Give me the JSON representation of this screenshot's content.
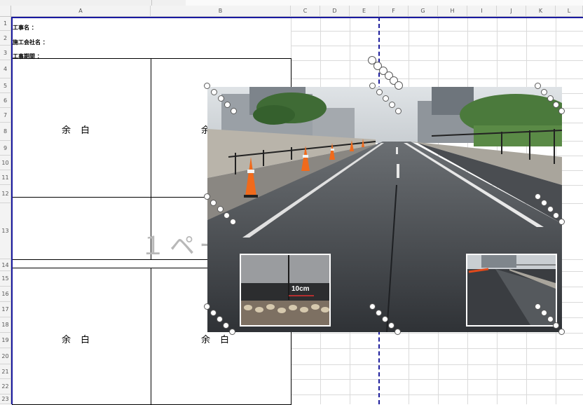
{
  "columns": [
    "A",
    "B",
    "C",
    "D",
    "E",
    "F",
    "G",
    "H",
    "I",
    "J",
    "K",
    "L"
  ],
  "rows": [
    "1",
    "2",
    "3",
    "4",
    "5",
    "6",
    "7",
    "8",
    "9",
    "10",
    "11",
    "12",
    "13",
    "14",
    "15",
    "16",
    "17",
    "18",
    "19",
    "20",
    "21",
    "22",
    "23"
  ],
  "header_fields": {
    "project_name": "工事名 ：",
    "contractor": "施工会社名 ：",
    "period": "工事期間 ："
  },
  "blank_label": "余白",
  "page_watermark": "１ページ",
  "photo": {
    "inset_cut_label": "10cm"
  },
  "colors": {
    "page_border": "#1a1aa0",
    "header_bg": "#f3f3f3",
    "gridline": "#dadada",
    "handle": "#5a5a5a"
  }
}
